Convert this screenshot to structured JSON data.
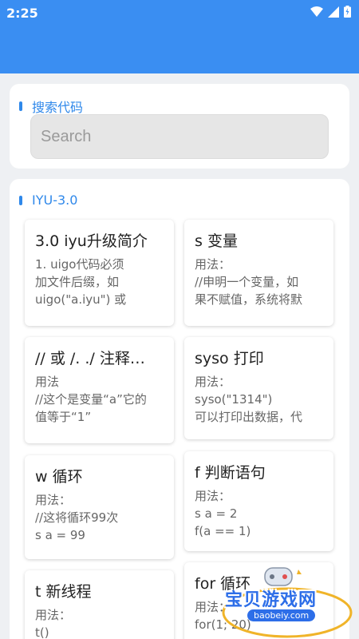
{
  "status_bar": {
    "time": "2:25"
  },
  "search_section": {
    "title": "搜索代码",
    "placeholder": "Search"
  },
  "iyu_section": {
    "title": "IYU-3.0",
    "items": [
      {
        "title": "3.0 iyu升级简介",
        "body": "1. uigo代码必须\n加文件后缀，如\nuigo(\"a.iyu\") 或"
      },
      {
        "title": "s 变量",
        "body": "用法：\n//申明一个变量，如\n果不赋值，系统将默"
      },
      {
        "title": "// 或 /. ./ 注释…",
        "body": "用法\n//这个是变量“a”它的\n值等于“1”"
      },
      {
        "title": "syso 打印",
        "body": "用法：\nsyso(\"1314\")\n可以打印出数据，代"
      },
      {
        "title": "w 循环",
        "body": "用法：\n//这将循环99次\ns a = 99"
      },
      {
        "title": "f 判断语句",
        "body": "用法：\ns a = 2\nf(a == 1)"
      },
      {
        "title": "t 新线程",
        "body": "用法：\nt()"
      },
      {
        "title": "for 循环",
        "body": "用法：\nfor(1; 20)"
      }
    ]
  },
  "watermark": {
    "text": "宝贝游戏网",
    "url": "baobeiy.com"
  }
}
